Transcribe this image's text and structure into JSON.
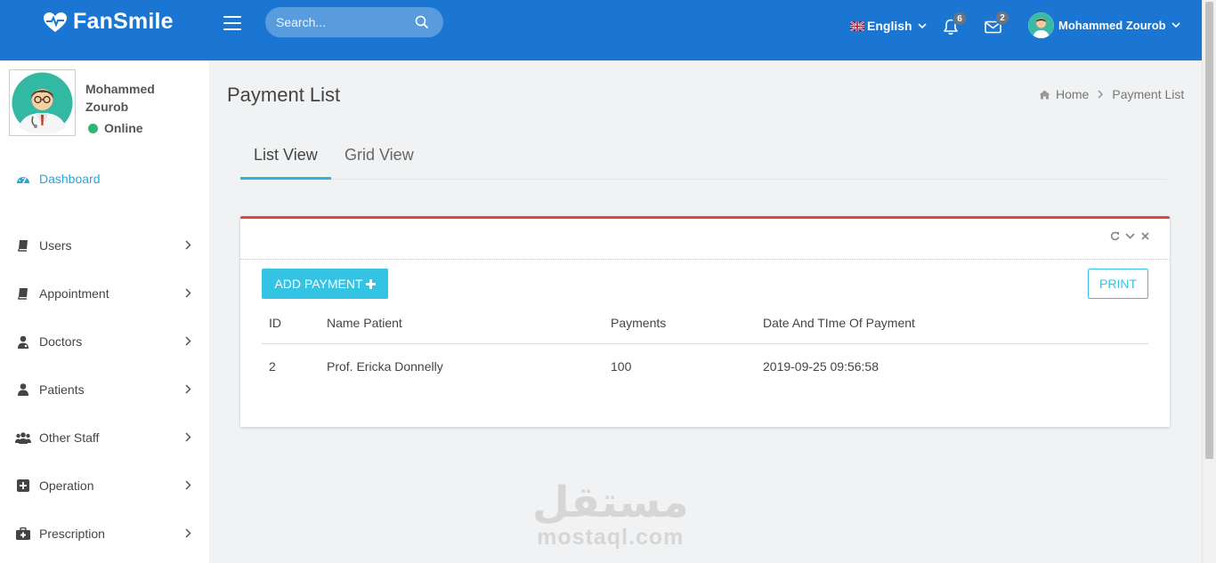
{
  "header": {
    "brand": "FanSmile",
    "search_placeholder": "Search...",
    "language": "English",
    "notifications_count": "6",
    "messages_count": "2",
    "user_name": "Mohammed Zourob"
  },
  "sidebar": {
    "profile_name": "Mohammed Zourob",
    "status": "Online",
    "items": [
      {
        "label": "Dashboard"
      },
      {
        "label": "Users"
      },
      {
        "label": "Appointment"
      },
      {
        "label": "Doctors"
      },
      {
        "label": "Patients"
      },
      {
        "label": "Other Staff"
      },
      {
        "label": "Operation"
      },
      {
        "label": "Prescription"
      }
    ]
  },
  "page": {
    "title": "Payment List",
    "breadcrumb": [
      "Home",
      "Payment List"
    ],
    "tabs": [
      "List View",
      "Grid View"
    ]
  },
  "card": {
    "add_button": "ADD PAYMENT",
    "print_button": "PRINT",
    "columns": [
      "ID",
      "Name Patient",
      "Payments",
      "Date And TIme Of Payment"
    ],
    "rows": [
      [
        "2",
        "Prof. Ericka Donnelly",
        "100",
        "2019-09-25 09:56:58"
      ]
    ]
  },
  "watermark": {
    "arabic": "مستقل",
    "latin": "mostaql.com"
  },
  "colors": {
    "header": "#1a76d2",
    "accent": "#34c3e3",
    "card_top": "#dc4a38",
    "active_menu": "#26a5d9",
    "online": "#2bb673"
  }
}
